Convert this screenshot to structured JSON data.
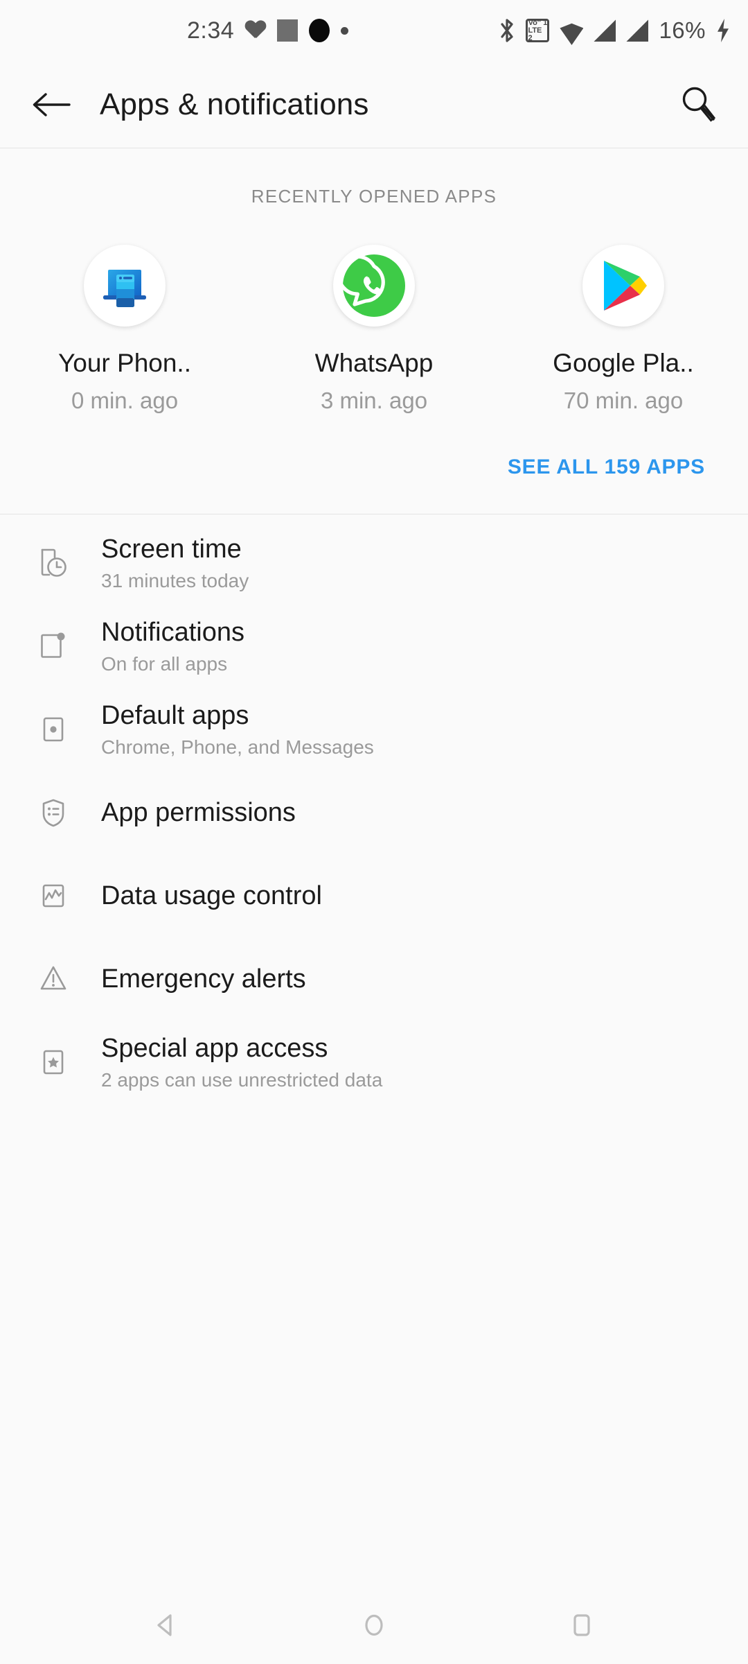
{
  "status_bar": {
    "time": "2:34",
    "battery": "16%",
    "icons_left": [
      "heart-icon",
      "gray-square-icon",
      "black-circle-icon",
      "small-dot-icon"
    ],
    "icons_right": [
      "bluetooth-icon",
      "volte-icon",
      "wifi-icon",
      "signal-icon-1",
      "signal-icon-2",
      "charging-bolt-icon"
    ],
    "volte_top": "Vo″ 1",
    "volte_bottom": "LTE 2"
  },
  "app_bar": {
    "back_icon": "arrow-left-icon",
    "title": "Apps & notifications",
    "search_icon": "search-icon"
  },
  "recent": {
    "section_label": "Recently opened apps",
    "apps": [
      {
        "name": "Your Phon..",
        "time": "0 min. ago",
        "icon": "your-phone-icon"
      },
      {
        "name": "WhatsApp",
        "time": "3 min. ago",
        "icon": "whatsapp-icon"
      },
      {
        "name": "Google Pla..",
        "time": "70 min. ago",
        "icon": "google-play-icon"
      }
    ],
    "see_all_label": "See all 159 apps"
  },
  "settings_list": [
    {
      "title": "Screen time",
      "subtitle": "31 minutes today",
      "icon": "screen-time-icon"
    },
    {
      "title": "Notifications",
      "subtitle": "On for all apps",
      "icon": "notifications-icon"
    },
    {
      "title": "Default apps",
      "subtitle": "Chrome, Phone, and Messages",
      "icon": "default-apps-icon"
    },
    {
      "title": "App permissions",
      "subtitle": "",
      "icon": "shield-list-icon"
    },
    {
      "title": "Data usage control",
      "subtitle": "",
      "icon": "data-usage-icon"
    },
    {
      "title": "Emergency alerts",
      "subtitle": "",
      "icon": "warning-triangle-icon"
    },
    {
      "title": "Special app access",
      "subtitle": "2 apps can use unrestricted data",
      "icon": "special-access-icon"
    }
  ],
  "nav_bar": {
    "back_icon": "nav-back-triangle-icon",
    "home_icon": "nav-home-circle-icon",
    "recents_icon": "nav-recents-square-icon"
  },
  "colors": {
    "background": "#fafafa",
    "accent_link": "#2c96ed",
    "primary_text": "#1b1b1b",
    "secondary_text": "#9a9a9a",
    "icon_gray": "#9a9a9a",
    "whatsapp_green": "#3ecb47"
  }
}
